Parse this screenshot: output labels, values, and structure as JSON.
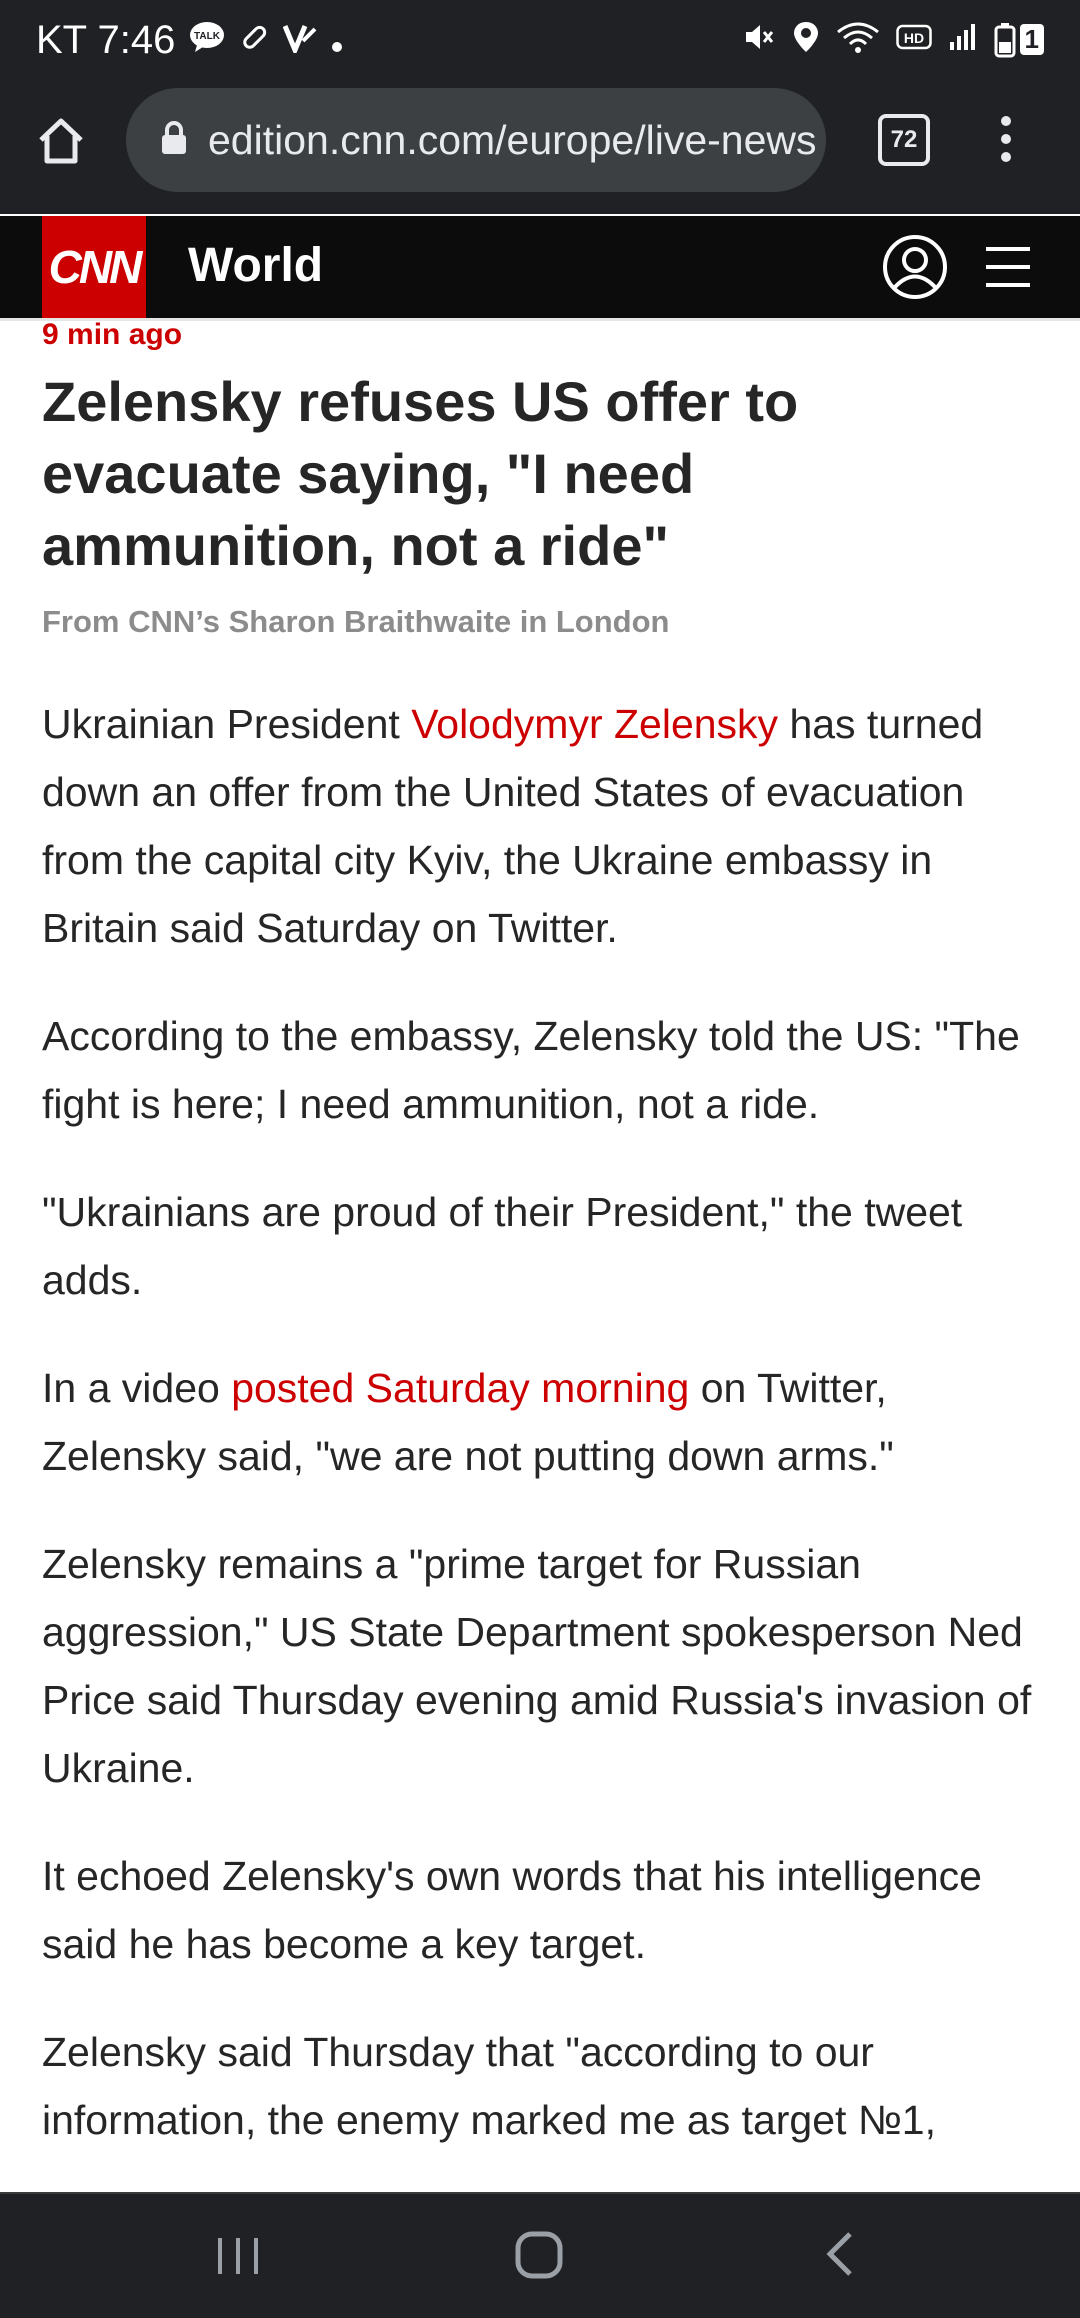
{
  "status_bar": {
    "carrier": "KT",
    "time": "7:46",
    "battery_level": "1"
  },
  "browser": {
    "url": "edition.cnn.com/europe/live-news",
    "tab_count": "72"
  },
  "site_header": {
    "logo": "CNN",
    "section": "World"
  },
  "article": {
    "timestamp": "9 min ago",
    "headline": "Zelensky refuses US offer to evacuate saying, \"I need ammunition, not a ride\"",
    "byline": "From CNN’s Sharon Braithwaite in London",
    "p1_before": "Ukrainian President ",
    "p1_link": "Volodymyr Zelensky",
    "p1_after": " has turned down an offer from the United States of evacuation from the capital city Kyiv, the Ukraine embassy in Britain said Saturday on Twitter.",
    "p2": "According to the embassy, Zelensky told the US: \"The fight is here; I need ammunition, not a ride.",
    "p3": "\"Ukrainians are proud of their President,\" the tweet adds.",
    "p4_before": "In a video ",
    "p4_link": "posted Saturday morning",
    "p4_after": " on Twitter, Zelensky said, \"we are not putting down arms.\"",
    "p5": "Zelensky remains a \"prime target for Russian aggression,\" US State Department spokesperson Ned Price said Thursday evening amid Russia's invasion of Ukraine.",
    "p6": "It echoed Zelensky's own words that his intelligence said he has become a key target.",
    "p7": "Zelensky said Thursday that \"according to our information, the enemy marked me as target №1,"
  },
  "icons": {
    "status": [
      "talk-icon",
      "pin-icon",
      "v-app-icon",
      "dot-icon",
      "mute-icon",
      "location-icon",
      "wifi-icon",
      "hd-icon",
      "signal-icon",
      "battery-icon"
    ],
    "browser": [
      "home-icon",
      "lock-icon",
      "tabs-icon",
      "more-icon"
    ],
    "header": [
      "account-icon",
      "menu-icon"
    ],
    "nav": [
      "recents-icon",
      "home-nav-icon",
      "back-icon"
    ]
  },
  "colors": {
    "accent": "#cc0000",
    "browser_chrome": "#202124",
    "header_bg": "#0c0c0c"
  }
}
